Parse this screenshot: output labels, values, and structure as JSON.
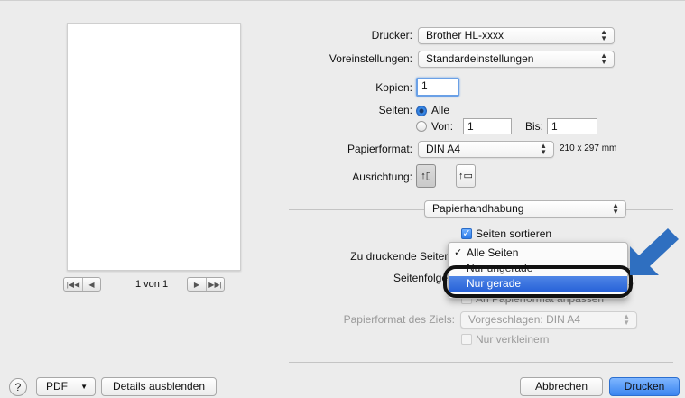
{
  "printer": {
    "label": "Drucker:",
    "value": "Brother HL-xxxx"
  },
  "presets": {
    "label": "Voreinstellungen:",
    "value": "Standardeinstellungen"
  },
  "copies": {
    "label": "Kopien:",
    "value": "1"
  },
  "pages": {
    "label": "Seiten:",
    "all_label": "Alle",
    "from_label": "Von:",
    "from_value": "1",
    "to_label": "Bis:",
    "to_value": "1"
  },
  "paper_size": {
    "label": "Papierformat:",
    "value": "DIN A4",
    "dimensions": "210 x 297 mm"
  },
  "orientation": {
    "label": "Ausrichtung:"
  },
  "section_popup": {
    "value": "Papierhandhabung"
  },
  "collate": {
    "label": "Seiten sortieren",
    "checked": true
  },
  "pages_to_print": {
    "label": "Zu druckende Seiten",
    "options": [
      "Alle Seiten",
      "Nur ungerade",
      "Nur gerade"
    ],
    "selected": "Alle Seiten",
    "highlighted": "Nur gerade"
  },
  "page_order": {
    "label": "Seitenfolge"
  },
  "scale_to_fit": {
    "label": "An Papierformat anpassen"
  },
  "destination_paper": {
    "label": "Papierformat des Ziels:",
    "value": "Vorgeschlagen: DIN A4"
  },
  "scale_down_only": {
    "label": "Nur verkleinern"
  },
  "preview": {
    "page_count": "1 von 1"
  },
  "footer": {
    "help": "?",
    "pdf": "PDF",
    "hide_details": "Details ausblenden",
    "cancel": "Abbrechen",
    "print": "Drucken"
  },
  "colors": {
    "accent": "#2862d8",
    "arrow": "#2f6fc0"
  }
}
